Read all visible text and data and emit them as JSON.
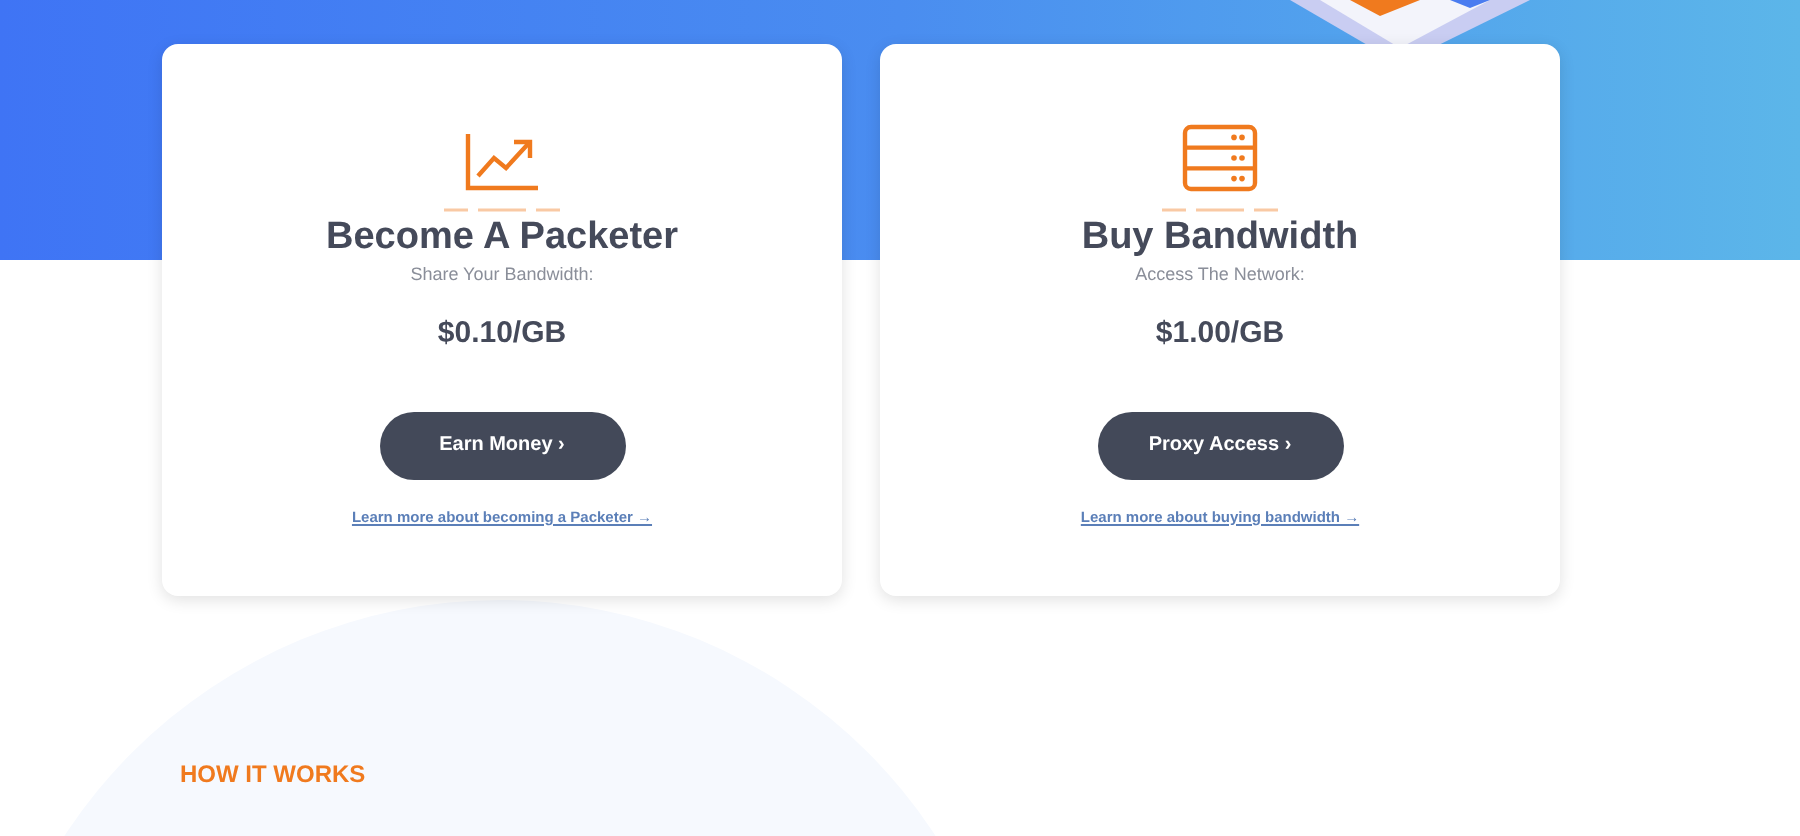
{
  "cards": [
    {
      "kind": "chart",
      "title": "Become A Packeter",
      "subtitle": "Share Your Bandwidth:",
      "price": "$0.10/GB",
      "button": "Earn Money ›",
      "link": "Learn more about becoming a Packeter →"
    },
    {
      "kind": "server",
      "title": "Buy Bandwidth",
      "subtitle": "Access The Network:",
      "price": "$1.00/GB",
      "button": "Proxy Access ›",
      "link": "Learn more about buying bandwidth →"
    }
  ],
  "section_label": "HOW IT WORKS"
}
